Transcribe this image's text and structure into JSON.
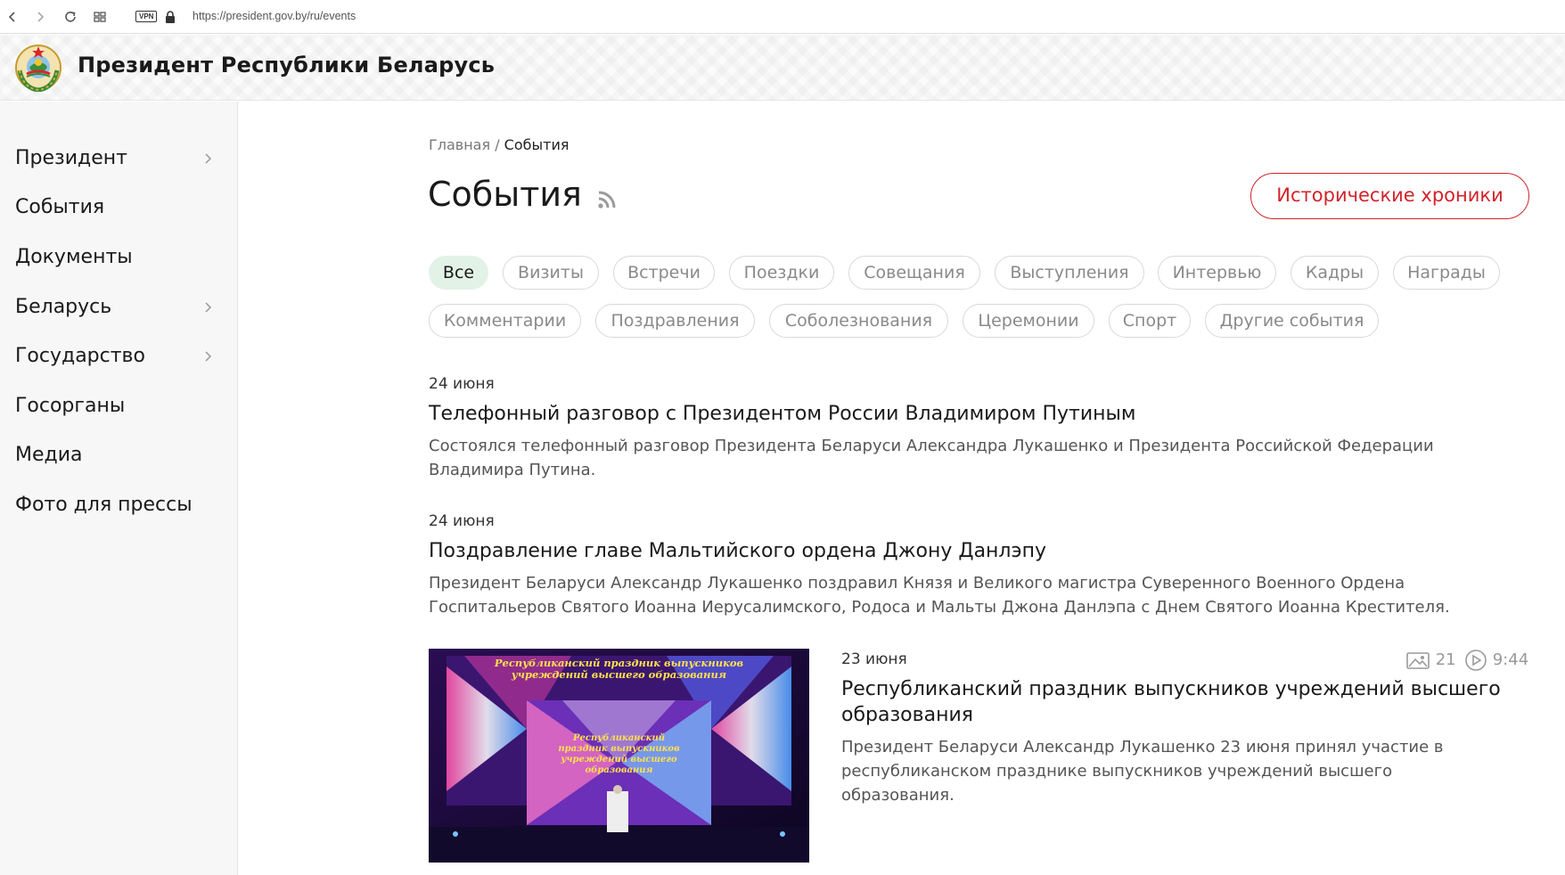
{
  "browser": {
    "vpn_label": "VPN",
    "url": "https://president.gov.by/ru/events"
  },
  "site": {
    "title": "Президент Республики Беларусь"
  },
  "sidebar": {
    "items": [
      {
        "label": "Президент",
        "has_children": true
      },
      {
        "label": "События",
        "has_children": false
      },
      {
        "label": "Документы",
        "has_children": false
      },
      {
        "label": "Беларусь",
        "has_children": true
      },
      {
        "label": "Государство",
        "has_children": true
      },
      {
        "label": "Госорганы",
        "has_children": false
      },
      {
        "label": "Медиа",
        "has_children": false
      },
      {
        "label": "Фото для прессы",
        "has_children": false
      }
    ]
  },
  "breadcrumb": {
    "home": "Главная",
    "separator": " / ",
    "current": "События"
  },
  "page": {
    "title": "События",
    "historical_button": "Исторические хроники"
  },
  "filters": [
    {
      "label": "Все",
      "active": true
    },
    {
      "label": "Визиты",
      "active": false
    },
    {
      "label": "Встречи",
      "active": false
    },
    {
      "label": "Поездки",
      "active": false
    },
    {
      "label": "Совещания",
      "active": false
    },
    {
      "label": "Выступления",
      "active": false
    },
    {
      "label": "Интервью",
      "active": false
    },
    {
      "label": "Кадры",
      "active": false
    },
    {
      "label": "Награды",
      "active": false
    },
    {
      "label": "Комментарии",
      "active": false
    },
    {
      "label": "Поздравления",
      "active": false
    },
    {
      "label": "Соболезнования",
      "active": false
    },
    {
      "label": "Церемонии",
      "active": false
    },
    {
      "label": "Спорт",
      "active": false
    },
    {
      "label": "Другие события",
      "active": false
    }
  ],
  "news": [
    {
      "date": "24 июня",
      "title": "Телефонный разговор с Президентом России Владимиром Путиным",
      "text_lines": [
        "Состоялся телефонный разговор Президента Беларуси Александра Лукашенко и Президента Российской Федерации",
        "Владимира Путина."
      ]
    },
    {
      "date": "24 июня",
      "title": "Поздравление главе Мальтийского ордена Джону Данлэпу",
      "text_lines": [
        "Президент Беларуси Александр Лукашенко поздравил Князя и Великого магистра Суверенного Военного Ордена",
        "Госпитальеров Святого Иоанна Иерусалимского, Родоса и Мальты Джона Данлэпа с Днем Святого Иоанна Крестителя."
      ]
    },
    {
      "date": "23 июня",
      "title_lines": [
        "Республиканский праздник выпускников учреждений высшего",
        "образования"
      ],
      "text_lines": [
        "Президент Беларуси Александр Лукашенко 23 июня принял участие в",
        "республиканском празднике выпускников учреждений высшего",
        "образования."
      ],
      "photo_count": "21",
      "video_duration": "9:44",
      "thumb_caption_top": [
        "Республиканский праздник выпускников",
        "учреждений высшего образования"
      ],
      "thumb_caption_screen": [
        "Республиканский",
        "праздник выпускников",
        "учреждений высшего",
        "образования"
      ]
    }
  ],
  "colors": {
    "accent_red": "#d2232a",
    "chip_active_bg": "#e3f2e6"
  }
}
